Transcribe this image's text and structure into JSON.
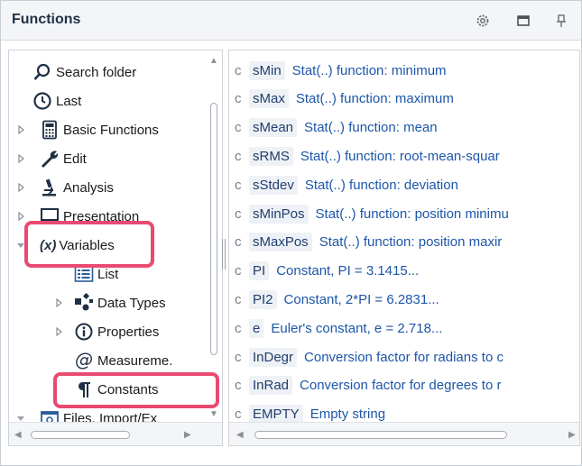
{
  "panel": {
    "title": "Functions"
  },
  "titlebar_icons": [
    "gear-icon",
    "maximize-icon",
    "pin-icon"
  ],
  "tree": {
    "items": [
      {
        "label": "Search folder",
        "icon": "search-icon"
      },
      {
        "label": "Last",
        "icon": "clock-icon"
      },
      {
        "label": "Basic Functions",
        "icon": "calculator-icon"
      },
      {
        "label": "Edit",
        "icon": "wrench-icon"
      },
      {
        "label": "Analysis",
        "icon": "microscope-icon"
      },
      {
        "label": "Presentation",
        "icon": "monitor-icon"
      },
      {
        "label": "Variables",
        "icon": "variable-icon",
        "prefix": "(x)"
      },
      {
        "label": "List",
        "icon": "list-icon"
      },
      {
        "label": "Data Types",
        "icon": "datatypes-icon"
      },
      {
        "label": "Properties",
        "icon": "info-icon"
      },
      {
        "label": "Measureme.",
        "icon": "at-icon"
      },
      {
        "label": "Constants",
        "icon": "pilcrow-icon"
      },
      {
        "label": "Files, Import/Ex",
        "icon": "folder-icon"
      }
    ]
  },
  "functions": [
    {
      "type": "c",
      "name": "sMin",
      "desc": "Stat(..) function: minimum"
    },
    {
      "type": "c",
      "name": "sMax",
      "desc": "Stat(..) function: maximum"
    },
    {
      "type": "c",
      "name": "sMean",
      "desc": "Stat(..) function: mean"
    },
    {
      "type": "c",
      "name": "sRMS",
      "desc": "Stat(..) function: root-mean-squar"
    },
    {
      "type": "c",
      "name": "sStdev",
      "desc": "Stat(..) function: deviation"
    },
    {
      "type": "c",
      "name": "sMinPos",
      "desc": "Stat(..) function: position minimu"
    },
    {
      "type": "c",
      "name": "sMaxPos",
      "desc": "Stat(..) function: position maxir"
    },
    {
      "type": "c",
      "name": "PI",
      "desc": "Constant, PI = 3.1415..."
    },
    {
      "type": "c",
      "name": "PI2",
      "desc": "Constant, 2*PI = 6.2831..."
    },
    {
      "type": "c",
      "name": "e",
      "desc": "Euler's constant, e = 2.718..."
    },
    {
      "type": "c",
      "name": "InDegr",
      "desc": "Conversion factor for radians to c"
    },
    {
      "type": "c",
      "name": "InRad",
      "desc": "Conversion factor for degrees to r"
    },
    {
      "type": "c",
      "name": "EMPTY",
      "desc": "Empty string"
    }
  ],
  "colors": {
    "highlight": "#e84a72",
    "desc_text": "#1d56a8",
    "name_text": "#1f3f6d",
    "title_text": "#1f3044"
  }
}
